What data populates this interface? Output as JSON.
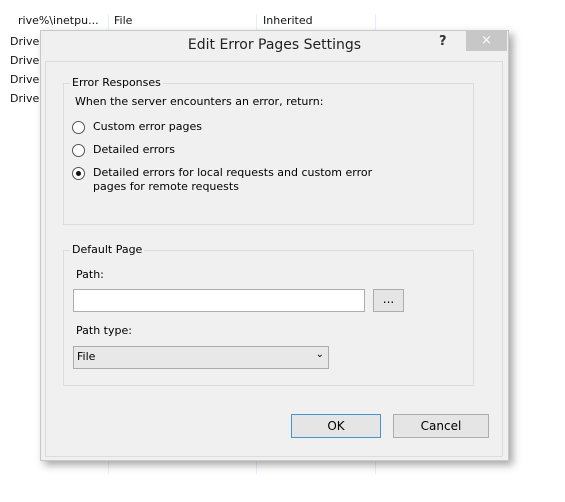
{
  "background": {
    "rows": [
      [
        "rive%\\inetpu...",
        "File",
        "Inherited"
      ],
      [
        "Drive'"
      ],
      [
        "Drive'"
      ],
      [
        "Drive'"
      ],
      [
        "Drive'"
      ]
    ]
  },
  "dialog": {
    "title": "Edit Error Pages Settings",
    "help": "?",
    "close": "×",
    "error_responses": {
      "legend": "Error Responses",
      "prompt": "When the server encounters an error, return:",
      "options": [
        {
          "label": "Custom error pages",
          "selected": false
        },
        {
          "label": "Detailed errors",
          "selected": false
        },
        {
          "label": "Detailed errors for local requests and custom error pages for remote requests",
          "selected": true
        }
      ]
    },
    "default_page": {
      "legend": "Default Page",
      "path_label": "Path:",
      "path_value": "",
      "browse": "...",
      "path_type_label": "Path type:",
      "path_type_value": "File"
    },
    "ok": "OK",
    "cancel": "Cancel"
  }
}
